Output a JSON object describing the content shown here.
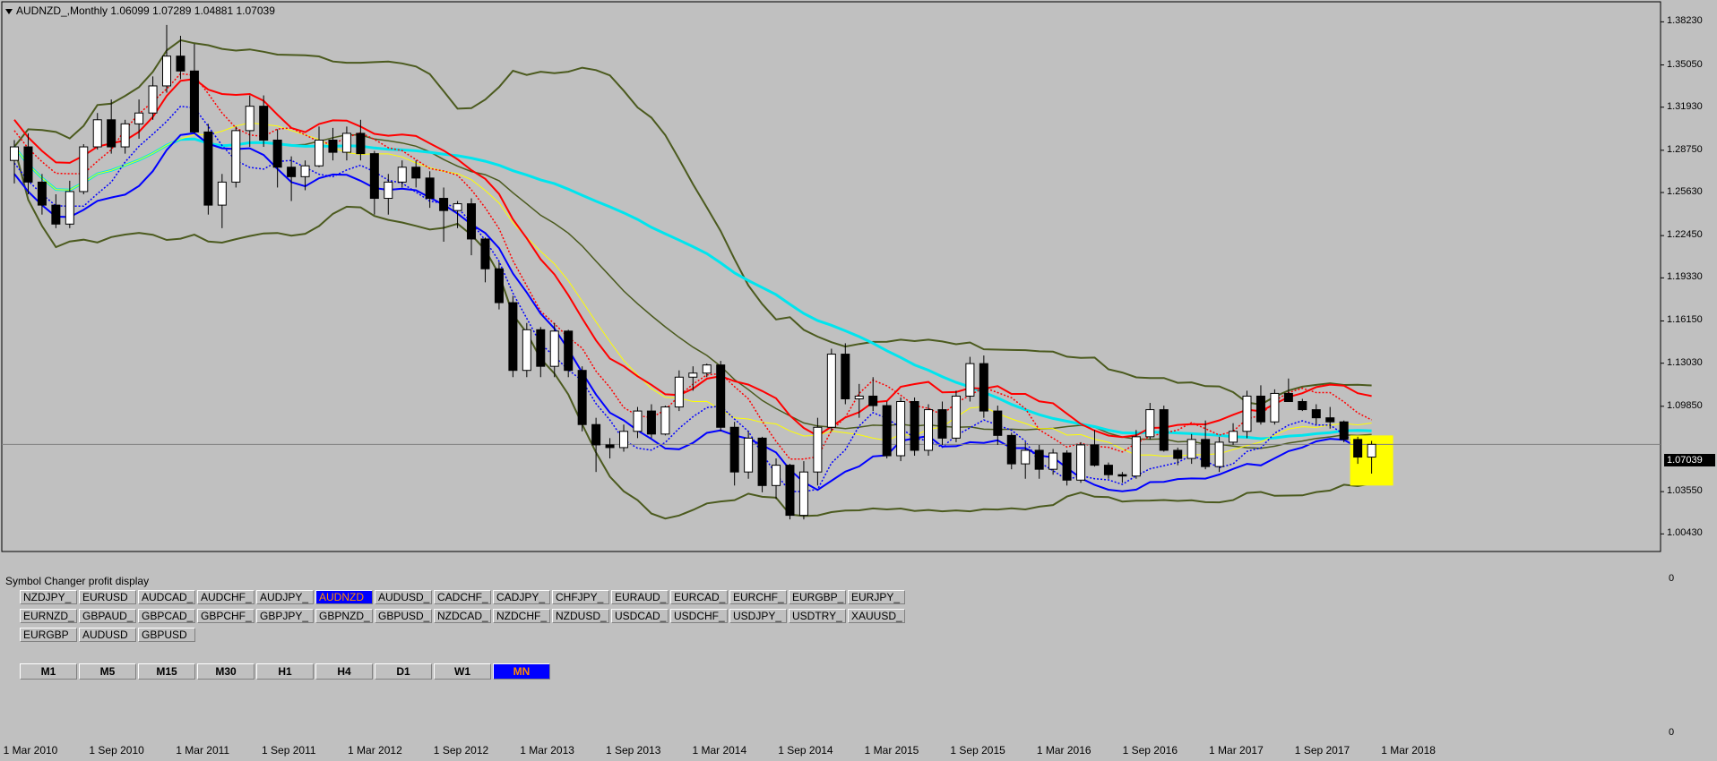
{
  "chart": {
    "title": "AUDNZD_,Monthly  1.06099 1.07289 1.04881 1.07039",
    "current_price_label": "1.07039",
    "price_axis_labels": [
      "1.38230",
      "1.35050",
      "1.31930",
      "1.28750",
      "1.25630",
      "1.22450",
      "1.19330",
      "1.16150",
      "1.13030",
      "1.09850",
      "1.03550",
      "1.00430"
    ],
    "time_axis_labels": [
      "1 Mar 2010",
      "1 Sep 2010",
      "1 Mar 2011",
      "1 Sep 2011",
      "1 Mar 2012",
      "1 Sep 2012",
      "1 Mar 2013",
      "1 Sep 2013",
      "1 Mar 2014",
      "1 Sep 2014",
      "1 Mar 2015",
      "1 Sep 2015",
      "1 Mar 2016",
      "1 Sep 2016",
      "1 Mar 2017",
      "1 Sep 2017",
      "1 Mar 2018"
    ],
    "colors": {
      "background": "#c0c0c0",
      "bull_candle": "#ffffff",
      "bear_candle": "#000000",
      "bollinger": "#4b5a1e",
      "ma_red": "#ff0000",
      "ma_blue": "#0000ff",
      "ma_cyan": "#00e5ee",
      "ma_yellow": "#ffff00",
      "highlight": "#ffff00"
    }
  },
  "chart_data": {
    "type": "candlestick",
    "title": "AUDNZD_,Monthly",
    "x_start": "2010-01",
    "ylim": [
      0.9913,
      1.3971
    ],
    "ohlc": [
      [
        1.28,
        1.295,
        1.263,
        1.29
      ],
      [
        1.29,
        1.3,
        1.255,
        1.264
      ],
      [
        1.264,
        1.27,
        1.24,
        1.247
      ],
      [
        1.247,
        1.255,
        1.23,
        1.233
      ],
      [
        1.233,
        1.265,
        1.23,
        1.257
      ],
      [
        1.257,
        1.292,
        1.255,
        1.29
      ],
      [
        1.29,
        1.315,
        1.288,
        1.31
      ],
      [
        1.31,
        1.325,
        1.285,
        1.29
      ],
      [
        1.29,
        1.31,
        1.285,
        1.307
      ],
      [
        1.307,
        1.325,
        1.296,
        1.315
      ],
      [
        1.315,
        1.342,
        1.31,
        1.335
      ],
      [
        1.335,
        1.38,
        1.33,
        1.357
      ],
      [
        1.357,
        1.372,
        1.34,
        1.346
      ],
      [
        1.346,
        1.366,
        1.3,
        1.301
      ],
      [
        1.301,
        1.307,
        1.24,
        1.247
      ],
      [
        1.247,
        1.27,
        1.23,
        1.264
      ],
      [
        1.264,
        1.305,
        1.26,
        1.302
      ],
      [
        1.302,
        1.328,
        1.29,
        1.32
      ],
      [
        1.32,
        1.328,
        1.29,
        1.295
      ],
      [
        1.295,
        1.303,
        1.26,
        1.275
      ],
      [
        1.275,
        1.283,
        1.25,
        1.268
      ],
      [
        1.268,
        1.28,
        1.258,
        1.276
      ],
      [
        1.276,
        1.305,
        1.275,
        1.295
      ],
      [
        1.295,
        1.304,
        1.28,
        1.286
      ],
      [
        1.286,
        1.305,
        1.28,
        1.3
      ],
      [
        1.3,
        1.31,
        1.28,
        1.285
      ],
      [
        1.285,
        1.287,
        1.24,
        1.252
      ],
      [
        1.252,
        1.27,
        1.24,
        1.264
      ],
      [
        1.264,
        1.28,
        1.26,
        1.275
      ],
      [
        1.275,
        1.28,
        1.26,
        1.267
      ],
      [
        1.267,
        1.272,
        1.245,
        1.252
      ],
      [
        1.252,
        1.26,
        1.22,
        1.243
      ],
      [
        1.243,
        1.25,
        1.23,
        1.248
      ],
      [
        1.248,
        1.252,
        1.21,
        1.222
      ],
      [
        1.222,
        1.223,
        1.19,
        1.2
      ],
      [
        1.2,
        1.205,
        1.17,
        1.175
      ],
      [
        1.175,
        1.18,
        1.12,
        1.125
      ],
      [
        1.125,
        1.16,
        1.12,
        1.155
      ],
      [
        1.155,
        1.157,
        1.12,
        1.128
      ],
      [
        1.128,
        1.16,
        1.12,
        1.154
      ],
      [
        1.154,
        1.155,
        1.12,
        1.125
      ],
      [
        1.125,
        1.128,
        1.08,
        1.085
      ],
      [
        1.085,
        1.09,
        1.05,
        1.07
      ],
      [
        1.07,
        1.075,
        1.06,
        1.068
      ],
      [
        1.068,
        1.085,
        1.065,
        1.08
      ],
      [
        1.08,
        1.098,
        1.075,
        1.095
      ],
      [
        1.095,
        1.1,
        1.075,
        1.078
      ],
      [
        1.078,
        1.099,
        1.077,
        1.098
      ],
      [
        1.098,
        1.125,
        1.095,
        1.12
      ],
      [
        1.12,
        1.128,
        1.11,
        1.123
      ],
      [
        1.123,
        1.13,
        1.12,
        1.129
      ],
      [
        1.129,
        1.132,
        1.08,
        1.083
      ],
      [
        1.083,
        1.087,
        1.04,
        1.05
      ],
      [
        1.05,
        1.08,
        1.045,
        1.075
      ],
      [
        1.075,
        1.076,
        1.035,
        1.04
      ],
      [
        1.04,
        1.06,
        1.03,
        1.055
      ],
      [
        1.055,
        1.056,
        1.015,
        1.018
      ],
      [
        1.018,
        1.058,
        1.015,
        1.05
      ],
      [
        1.05,
        1.09,
        1.04,
        1.083
      ],
      [
        1.083,
        1.141,
        1.08,
        1.137
      ],
      [
        1.137,
        1.145,
        1.1,
        1.104
      ],
      [
        1.104,
        1.115,
        1.09,
        1.106
      ],
      [
        1.106,
        1.12,
        1.095,
        1.099
      ],
      [
        1.099,
        1.102,
        1.06,
        1.062
      ],
      [
        1.062,
        1.105,
        1.058,
        1.102
      ],
      [
        1.102,
        1.105,
        1.062,
        1.066
      ],
      [
        1.066,
        1.1,
        1.062,
        1.096
      ],
      [
        1.096,
        1.102,
        1.07,
        1.075
      ],
      [
        1.075,
        1.11,
        1.072,
        1.106
      ],
      [
        1.106,
        1.135,
        1.102,
        1.13
      ],
      [
        1.13,
        1.136,
        1.09,
        1.095
      ],
      [
        1.095,
        1.099,
        1.07,
        1.077
      ],
      [
        1.077,
        1.079,
        1.052,
        1.056
      ],
      [
        1.056,
        1.072,
        1.045,
        1.066
      ],
      [
        1.066,
        1.07,
        1.045,
        1.052
      ],
      [
        1.052,
        1.067,
        1.048,
        1.064
      ],
      [
        1.064,
        1.066,
        1.04,
        1.044
      ],
      [
        1.044,
        1.072,
        1.042,
        1.07
      ],
      [
        1.07,
        1.081,
        1.054,
        1.055
      ],
      [
        1.055,
        1.057,
        1.045,
        1.048
      ],
      [
        1.048,
        1.05,
        1.042,
        1.047
      ],
      [
        1.047,
        1.081,
        1.045,
        1.076
      ],
      [
        1.076,
        1.101,
        1.074,
        1.096
      ],
      [
        1.096,
        1.099,
        1.065,
        1.066
      ],
      [
        1.066,
        1.068,
        1.055,
        1.06
      ],
      [
        1.06,
        1.078,
        1.056,
        1.074
      ],
      [
        1.074,
        1.088,
        1.052,
        1.054
      ],
      [
        1.054,
        1.076,
        1.05,
        1.072
      ],
      [
        1.072,
        1.086,
        1.07,
        1.08
      ],
      [
        1.08,
        1.11,
        1.075,
        1.106
      ],
      [
        1.106,
        1.114,
        1.085,
        1.087
      ],
      [
        1.087,
        1.111,
        1.085,
        1.108
      ],
      [
        1.108,
        1.119,
        1.102,
        1.102
      ],
      [
        1.102,
        1.104,
        1.095,
        1.096
      ],
      [
        1.096,
        1.1,
        1.085,
        1.09
      ],
      [
        1.09,
        1.098,
        1.082,
        1.087
      ],
      [
        1.087,
        1.088,
        1.072,
        1.074
      ],
      [
        1.074,
        1.076,
        1.056,
        1.061
      ],
      [
        1.061,
        1.0729,
        1.0488,
        1.0704
      ]
    ],
    "highlight_last_candle": true
  },
  "symbol_changer": {
    "title": "Symbol Changer profit display",
    "symbols": [
      "NZDJPY_",
      "EURUSD",
      "AUDCAD_",
      "AUDCHF_",
      "AUDJPY_",
      "AUDNZD",
      "AUDUSD_",
      "CADCHF_",
      "CADJPY_",
      "CHFJPY_",
      "EURAUD_",
      "EURCAD_",
      "EURCHF_",
      "EURGBP_",
      "EURJPY_",
      "EURNZD_",
      "GBPAUD_",
      "GBPCAD_",
      "GBPCHF_",
      "GBPJPY_",
      "GBPNZD_",
      "GBPUSD_",
      "NZDCAD_",
      "NZDCHF_",
      "NZDUSD_",
      "USDCAD_",
      "USDCHF_",
      "USDJPY_",
      "USDTRY_",
      "XAUUSD_",
      "EURGBP",
      "AUDUSD",
      "GBPUSD"
    ],
    "active_symbol": "AUDNZD",
    "timeframes": [
      "M1",
      "M5",
      "M15",
      "M30",
      "H1",
      "H4",
      "D1",
      "W1",
      "MN"
    ],
    "active_timeframe": "MN",
    "scale_top": "0",
    "scale_bottom": "0"
  }
}
